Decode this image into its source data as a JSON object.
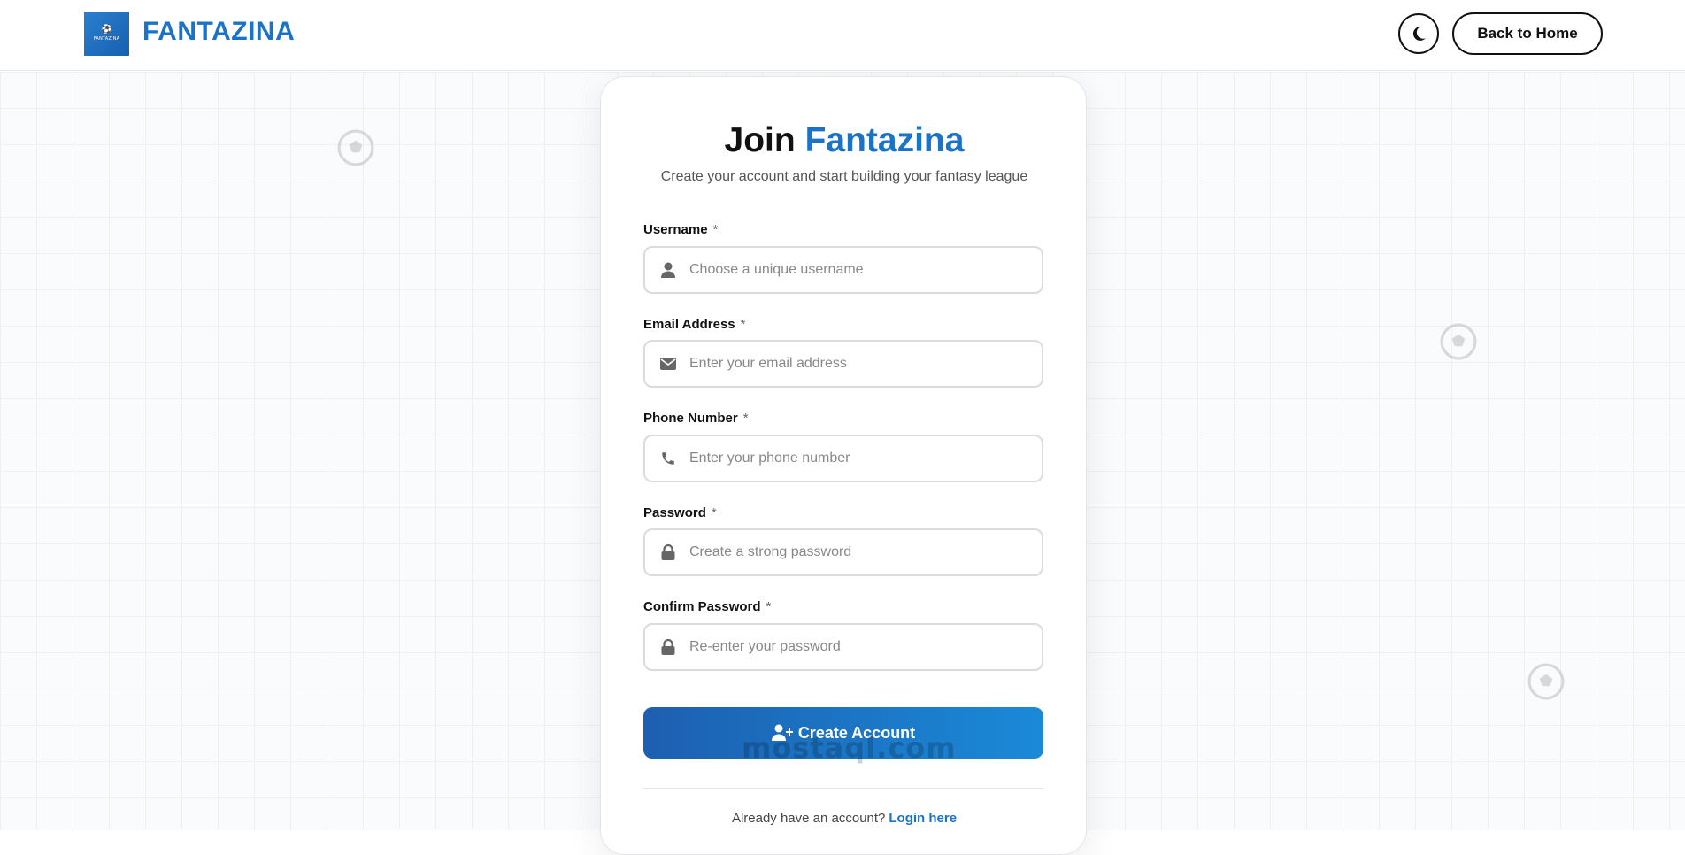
{
  "header": {
    "logo_text": "FANTAZINA",
    "brand": "FANTAZINA",
    "theme_icon": "moon-icon",
    "back_home": "Back to Home"
  },
  "form": {
    "title_prefix": "Join",
    "title_accent": "Fantazina",
    "subtitle": "Create your account and start building your fantasy league",
    "required_mark": "*",
    "fields": [
      {
        "label": "Username",
        "placeholder": "Choose a unique username",
        "icon": "user-icon"
      },
      {
        "label": "Email Address",
        "placeholder": "Enter your email address",
        "icon": "envelope-icon"
      },
      {
        "label": "Phone Number",
        "placeholder": "Enter your phone number",
        "icon": "phone-icon"
      },
      {
        "label": "Password",
        "placeholder": "Create a strong password",
        "icon": "lock-icon"
      },
      {
        "label": "Confirm Password",
        "placeholder": "Re-enter your password",
        "icon": "lock-icon"
      }
    ],
    "submit": "Create Account",
    "login_prompt": "Already have an account?",
    "login_link": "Login here"
  },
  "watermark": "mostaql.com",
  "colors": {
    "accent": "#1a73c8",
    "button_start": "#1d5fb0",
    "button_end": "#1a8ad8"
  }
}
